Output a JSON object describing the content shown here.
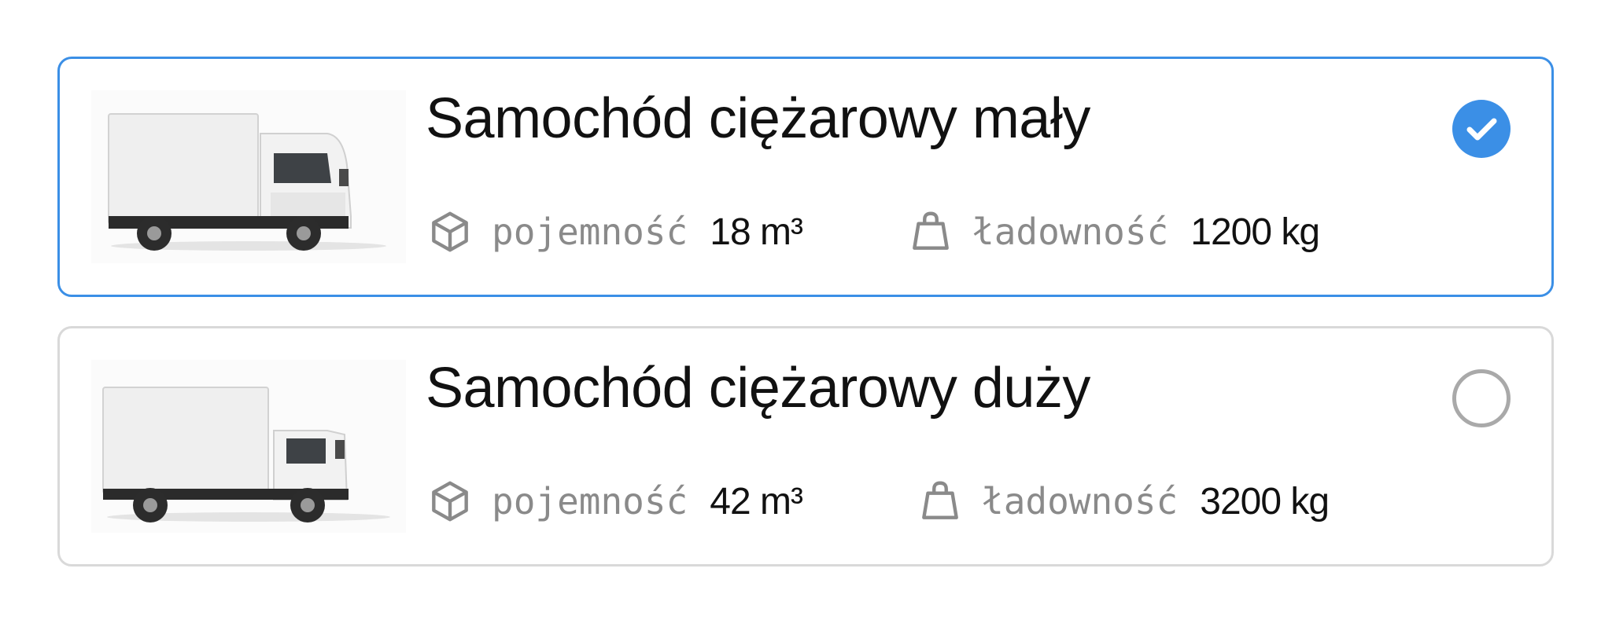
{
  "accent_color": "#3b8fe6",
  "options": [
    {
      "title": "Samochód ciężarowy mały",
      "capacity_label": "pojemność",
      "capacity_value": "18 m³",
      "load_label": "ładowność",
      "load_value": "1200 kg",
      "selected": true,
      "image_icon": "small-truck-image"
    },
    {
      "title": "Samochód ciężarowy duży",
      "capacity_label": "pojemność",
      "capacity_value": "42 m³",
      "load_label": "ładowność",
      "load_value": "3200 kg",
      "selected": false,
      "image_icon": "large-truck-image"
    }
  ],
  "icons": {
    "capacity": "box-icon",
    "load": "bag-icon",
    "selected": "check-circle-icon",
    "unselected": "radio-empty-icon"
  }
}
